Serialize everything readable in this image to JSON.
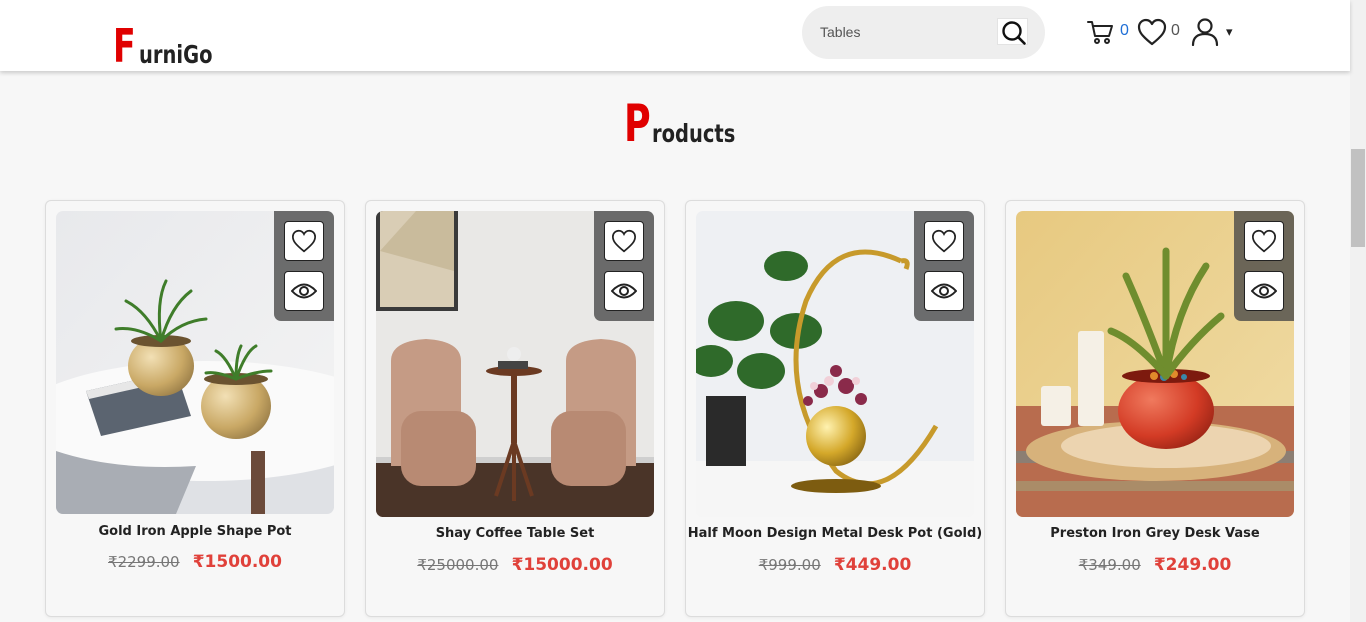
{
  "brand": {
    "initial": "F",
    "rest": "urniGo"
  },
  "search": {
    "placeholder": "Tables",
    "icon": "search-icon"
  },
  "header": {
    "cart_count": "0",
    "wishlist_count": "0",
    "user_caret": "▾",
    "accent_color": "#e00000",
    "cart_count_color": "#1f6fd6"
  },
  "section": {
    "title_initial": "P",
    "title_rest": "roducts"
  },
  "products": [
    {
      "name": "Gold Iron Apple Shape Pot",
      "old_price": "₹2299.00",
      "new_price": "₹1500.00"
    },
    {
      "name": "Shay Coffee Table Set",
      "old_price": "₹25000.00",
      "new_price": "₹15000.00"
    },
    {
      "name": "Half Moon Design Metal Desk Pot (Gold)",
      "old_price": "₹999.00",
      "new_price": "₹449.00"
    },
    {
      "name": "Preston Iron Grey Desk Vase",
      "old_price": "₹349.00",
      "new_price": "₹249.00"
    }
  ],
  "price_color": "#e0413a"
}
